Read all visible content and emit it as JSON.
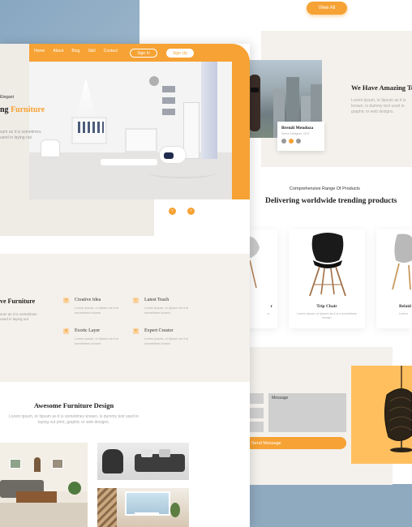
{
  "back": {
    "view_all": "View All",
    "testimonial": {
      "title": "We Have Amazing Te",
      "text": "Lorem ipsum, or lipsum as it is known, is dummy text used in graphic or web designs.",
      "name": "Brendi Mendoza",
      "role": "Senior Designer, CEO"
    },
    "range_sub": "Comprehensive Range Of Products",
    "range_title": "Delivering worldwide trending products",
    "products": [
      {
        "name": "r",
        "desc": "a"
      },
      {
        "name": "Trip Chair",
        "desc": "Lorem ipsum, or lipsum as it is a sometimes known"
      },
      {
        "name": "Belaid",
        "desc": "Lorem"
      }
    ],
    "contact": {
      "message_label": "Message",
      "send_label": "Send Message"
    }
  },
  "front": {
    "nav": [
      "Home",
      "About",
      "Blog",
      "Skill",
      "Contact"
    ],
    "sign_in": "Sign In",
    "sign_up": "Sign Up",
    "hero": {
      "small": "Elegant",
      "title_plain": "ng ",
      "title_accent": "Furniture",
      "text": "sum as it is sometimes used in laying out"
    },
    "slider": {
      "prev": "‹",
      "next": "›"
    },
    "features": {
      "title": "ve Furniture",
      "text": "sum as it is sometimes used in laying out",
      "items": [
        {
          "name": "Creative Idea",
          "desc": "Lorem ipsum, or lipsum as it is sometimes known"
        },
        {
          "name": "Latest Teach",
          "desc": "Lorem ipsum, or lipsum as it is sometimes known"
        },
        {
          "name": "Exotic Layer",
          "desc": "Lorem ipsum, or lipsum as it is sometimes known"
        },
        {
          "name": "Expert Creator",
          "desc": "Lorem ipsum, or lipsum as it is sometimes known"
        }
      ]
    },
    "design": {
      "title": "Awesome Furniture Design",
      "text": "Lorem ipsum, or lipsum as it is sometimes known, is dummy text used in laying out print, graphic or web designs."
    }
  },
  "colors": {
    "accent": "#f6a234",
    "beige": "#f4f1ec"
  }
}
